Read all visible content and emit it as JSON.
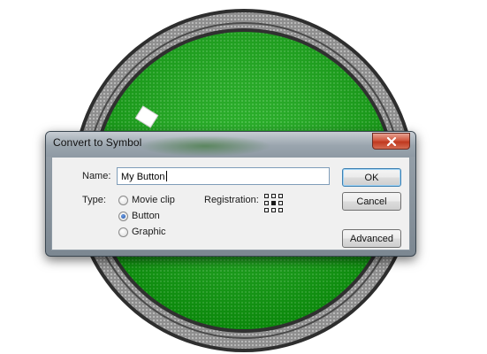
{
  "dialog": {
    "title": "Convert to Symbol",
    "name_label": "Name:",
    "name_value": "My Button",
    "type_label": "Type:",
    "type_options": [
      {
        "label": "Movie clip",
        "checked": false
      },
      {
        "label": "Button",
        "checked": true
      },
      {
        "label": "Graphic",
        "checked": false
      }
    ],
    "registration_label": "Registration:",
    "buttons": {
      "ok": "OK",
      "cancel": "Cancel",
      "advanced": "Advanced"
    }
  },
  "colors": {
    "button_green": "#0ea60e",
    "ring_gray": "#9a9a9a",
    "accent_blue": "#3c7fb1",
    "close_red": "#c0391f"
  },
  "icons": {
    "close": "close-x-icon",
    "registration": "registration-grid-icon"
  }
}
